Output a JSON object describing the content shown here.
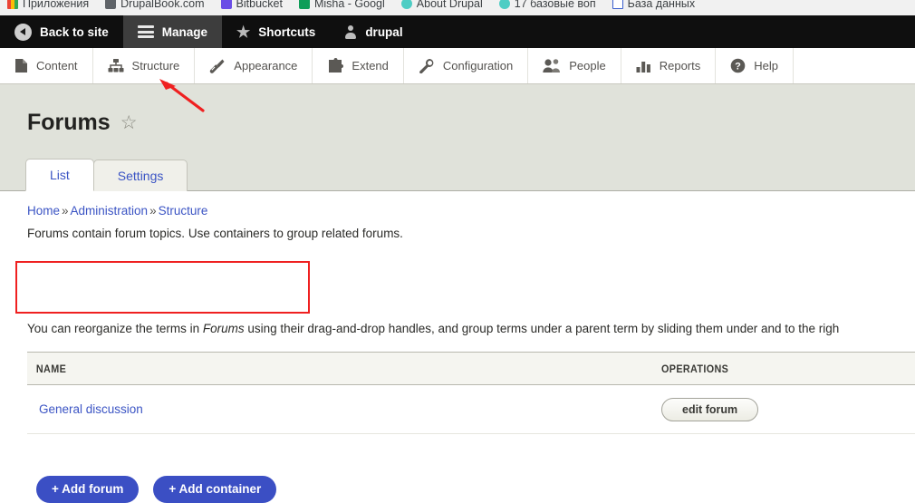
{
  "browser": {
    "bookmarks": [
      {
        "label": "Приложения",
        "icon": "apps-icon"
      },
      {
        "label": "DrupalBook.com",
        "icon": "drupalbook-icon"
      },
      {
        "label": "Bitbucket",
        "icon": "bitbucket-icon"
      },
      {
        "label": "Misha - Googl",
        "icon": "google-drive-icon"
      },
      {
        "label": "About Drupal",
        "icon": "drupal-icon"
      },
      {
        "label": "17 базовые воп",
        "icon": "drupal-icon"
      },
      {
        "label": "База данных",
        "icon": "database-icon"
      }
    ]
  },
  "admin_toolbar": {
    "items": [
      {
        "label": "Back to site",
        "icon": "back-arrow-icon",
        "active": false
      },
      {
        "label": "Manage",
        "icon": "hamburger-icon",
        "active": true
      },
      {
        "label": "Shortcuts",
        "icon": "star-icon",
        "active": false
      },
      {
        "label": "drupal",
        "icon": "user-icon",
        "active": false
      }
    ]
  },
  "menu_bar": {
    "items": [
      {
        "label": "Content",
        "icon": "document-icon"
      },
      {
        "label": "Structure",
        "icon": "sitemap-icon"
      },
      {
        "label": "Appearance",
        "icon": "paintbrush-icon"
      },
      {
        "label": "Extend",
        "icon": "puzzle-piece-icon"
      },
      {
        "label": "Configuration",
        "icon": "wrench-icon"
      },
      {
        "label": "People",
        "icon": "people-icon"
      },
      {
        "label": "Reports",
        "icon": "bar-chart-icon"
      },
      {
        "label": "Help",
        "icon": "question-mark-icon"
      }
    ]
  },
  "page": {
    "title": "Forums",
    "star_icon": "☆",
    "tabs": [
      {
        "label": "List",
        "active": true
      },
      {
        "label": "Settings",
        "active": false
      }
    ],
    "breadcrumb": [
      {
        "label": "Home"
      },
      {
        "label": "Administration"
      },
      {
        "label": "Structure"
      }
    ],
    "breadcrumb_separator": "»",
    "lede": "Forums contain forum topics. Use containers to group related forums.",
    "actions": [
      {
        "label": "+ Add forum"
      },
      {
        "label": "+ Add container"
      }
    ],
    "dnd_note_before": "You can reorganize the terms in ",
    "dnd_note_em": "Forums",
    "dnd_note_after": " using their drag-and-drop handles, and group terms under a parent term by sliding them under and to the righ"
  },
  "table": {
    "headers": {
      "name": "NAME",
      "operations": "OPERATIONS"
    },
    "rows": [
      {
        "name": "General discussion",
        "operation": "edit forum"
      }
    ]
  },
  "annotations": {
    "arrow_color": "#ef2020",
    "box_color": "#ef2020"
  },
  "colors": {
    "accent_blue": "#3b54c4",
    "button_blue": "#3b4fc4",
    "header_band": "#e0e2da",
    "toolbar_black": "#0f0f0f"
  }
}
